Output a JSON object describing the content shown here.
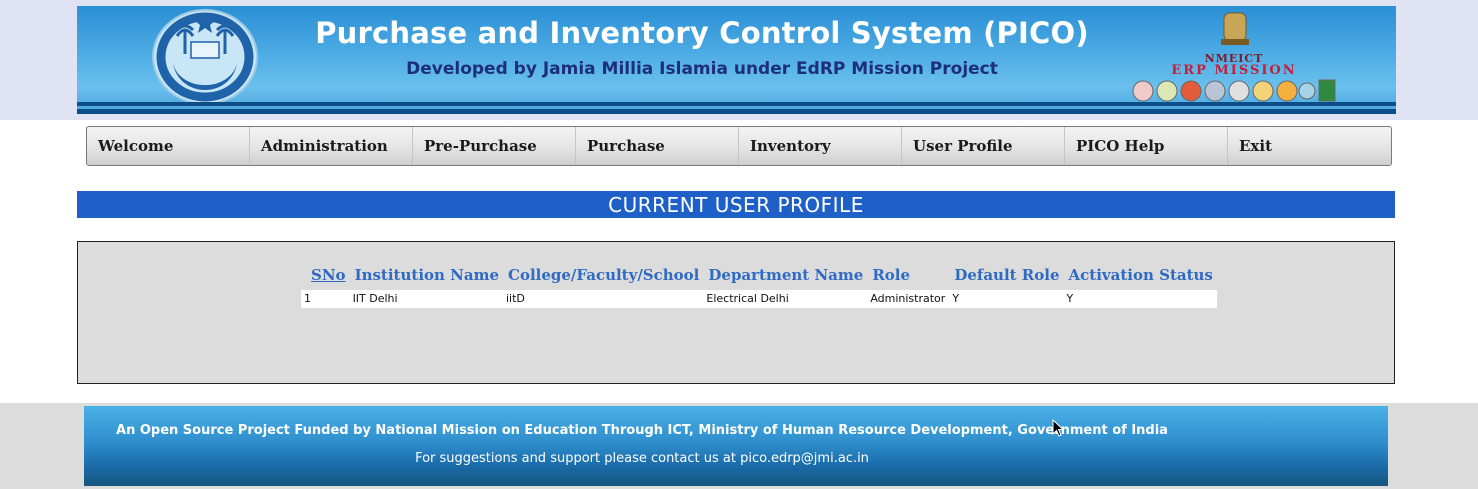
{
  "header": {
    "title": "Purchase and Inventory Control System (PICO)",
    "subtitle": "Developed by Jamia Millia Islamia under EdRP Mission Project",
    "right_logo": {
      "line1": "NMEICT",
      "line2": "ERP MISSION"
    }
  },
  "nav": {
    "items": [
      {
        "label": "Welcome"
      },
      {
        "label": "Administration"
      },
      {
        "label": "Pre-Purchase"
      },
      {
        "label": "Purchase"
      },
      {
        "label": "Inventory"
      },
      {
        "label": "User Profile"
      },
      {
        "label": "PICO Help"
      },
      {
        "label": "Exit"
      }
    ]
  },
  "section": {
    "title": "CURRENT USER PROFILE"
  },
  "table": {
    "columns": [
      "SNo",
      "Institution Name",
      "College/Faculty/School",
      "Department Name",
      "Role",
      "Default Role",
      "Activation Status"
    ],
    "rows": [
      [
        "1",
        "IIT Delhi",
        "iitD",
        "Electrical Delhi",
        "Administrator",
        "Y",
        "Y"
      ]
    ]
  },
  "footer": {
    "line1": "An Open Source Project Funded by National Mission on Education Through ICT, Ministry of Human Resource Development, Government of India",
    "line2": "For suggestions and support please contact us at pico.edrp@jmi.ac.in"
  },
  "colors": {
    "header_blue": "#2a8fd4",
    "section_bar": "#1f5fc8",
    "table_header_text": "#2f6bc4",
    "panel_bg": "#dcdcdc"
  }
}
